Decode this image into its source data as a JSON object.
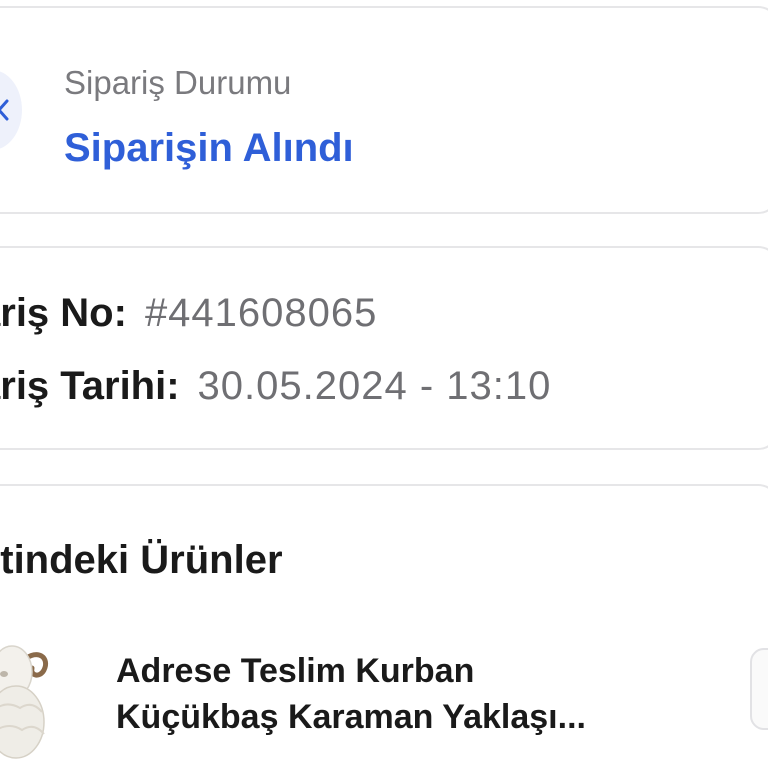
{
  "order_status": {
    "label": "Sipariş Durumu",
    "value": "Siparişin Alındı",
    "accent_color": "#2f5fd8",
    "icon": "chevron-left-icon"
  },
  "order_info": {
    "number_label": "ariş No:",
    "number_value": "#441608065",
    "date_label": "ariş Tarihi:",
    "date_value": "30.05.2024 - 13:10"
  },
  "items_section": {
    "title": "etindeki Ürünler",
    "items": [
      {
        "title_line1": "Adrese Teslim Kurban",
        "title_line2": "Küçükbaş Karaman Yaklaşı...",
        "thumbnail_icon": "sheep-image"
      }
    ]
  }
}
